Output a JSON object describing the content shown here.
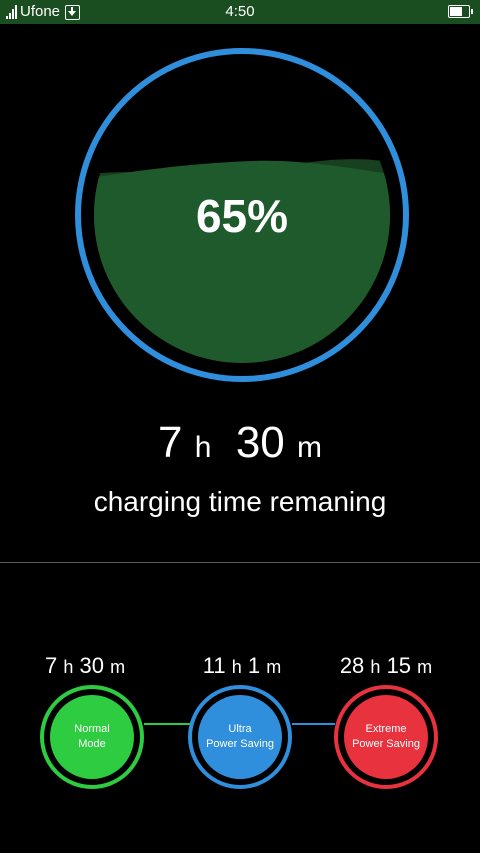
{
  "status_bar": {
    "carrier": "Ufone",
    "time": "4:50"
  },
  "battery": {
    "percent_label": "65%",
    "level": 0.65
  },
  "charging": {
    "hours": "7",
    "hours_unit": "h",
    "minutes": "30",
    "minutes_unit": "m",
    "label": "charging time remaning"
  },
  "modes": [
    {
      "hours": "7",
      "hours_unit": "h",
      "minutes": "30",
      "minutes_unit": "m",
      "line1": "Normal",
      "line2": "Mode",
      "color": "#2ecc40"
    },
    {
      "hours": "11",
      "hours_unit": "h",
      "minutes": "1",
      "minutes_unit": "m",
      "line1": "Ultra",
      "line2": "Power Saving",
      "color": "#2f8fdc"
    },
    {
      "hours": "28",
      "hours_unit": "h",
      "minutes": "15",
      "minutes_unit": "m",
      "line1": "Extreme",
      "line2": "Power Saving",
      "color": "#e8323e"
    }
  ],
  "colors": {
    "status_bar": "#1a4d1f",
    "ring": "#2f8fdc",
    "fill": "#1e5a2b",
    "fill_wave": "#173f20",
    "normal": "#2ecc40",
    "ultra": "#2f8fdc",
    "extreme": "#e8323e"
  }
}
